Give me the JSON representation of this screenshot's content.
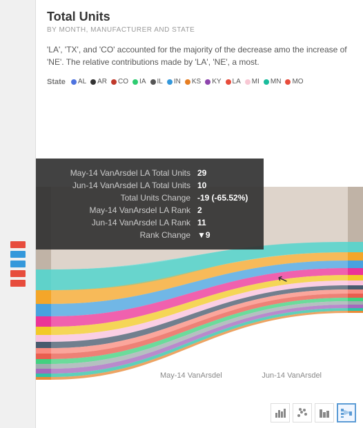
{
  "header": {
    "title": "Total Units",
    "subtitle": "BY MONTH, MANUFACTURER AND STATE",
    "description": "'LA', 'TX', and 'CO' accounted for the majority of the decrease amo the increase of 'NE'. The relative contributions made by 'LA', 'NE', a most."
  },
  "legend": {
    "label": "State",
    "items": [
      {
        "name": "AL",
        "color": "#4e73df"
      },
      {
        "name": "AR",
        "color": "#333"
      },
      {
        "name": "CO",
        "color": "#c0392b"
      },
      {
        "name": "IA",
        "color": "#2ecc71"
      },
      {
        "name": "IL",
        "color": "#555"
      },
      {
        "name": "IN",
        "color": "#3498db"
      },
      {
        "name": "KS",
        "color": "#e67e22"
      },
      {
        "name": "KY",
        "color": "#8e44ad"
      },
      {
        "name": "LA",
        "color": "#e74c3c"
      },
      {
        "name": "MI",
        "color": "#f8c8d4"
      },
      {
        "name": "MN",
        "color": "#1abc9c"
      },
      {
        "name": "MO",
        "color": "#e74c3c"
      }
    ]
  },
  "tooltip": {
    "rows": [
      {
        "key": "May-14 VanArsdel LA Total Units",
        "value": "29"
      },
      {
        "key": "Jun-14 VanArsdel LA Total Units",
        "value": "10"
      },
      {
        "key": "Total Units Change",
        "value": "-19 (-65.52%)"
      },
      {
        "key": "May-14 VanArsdel LA Rank",
        "value": "2"
      },
      {
        "key": "Jun-14 VanArsdel LA Rank",
        "value": "11"
      },
      {
        "key": "Rank Change",
        "value": "▼9"
      }
    ]
  },
  "axis": {
    "left_label": "May-14 VanArsdel",
    "right_label": "Jun-14 VanArsdel"
  },
  "toolbar": {
    "buttons": [
      {
        "icon": "📊",
        "label": "bar-chart",
        "active": false
      },
      {
        "icon": "⠿",
        "label": "scatter-chart",
        "active": false
      },
      {
        "icon": "📈",
        "label": "column-chart",
        "active": false
      },
      {
        "icon": "🗂",
        "label": "sankey-chart",
        "active": true
      }
    ]
  },
  "sidebar": {
    "colors": [
      "#e74c3c",
      "#3498db",
      "#2ecc71",
      "#f39c12",
      "#9b59b6",
      "#1abc9c",
      "#e67e22",
      "#34495e"
    ]
  },
  "colors": {
    "teal": "#1abc9c",
    "orange": "#e67e22",
    "blue": "#3498db",
    "pink": "#e91e8c",
    "yellow": "#f1c40f",
    "gray": "#95a5a6",
    "dark": "#34495e",
    "red": "#e74c3c",
    "green": "#2ecc71",
    "purple": "#9b59b6",
    "lightpink": "#f8bbd9",
    "salmon": "#fa8072",
    "navy": "#2c3e50",
    "darkgray": "#7f8c8d"
  }
}
